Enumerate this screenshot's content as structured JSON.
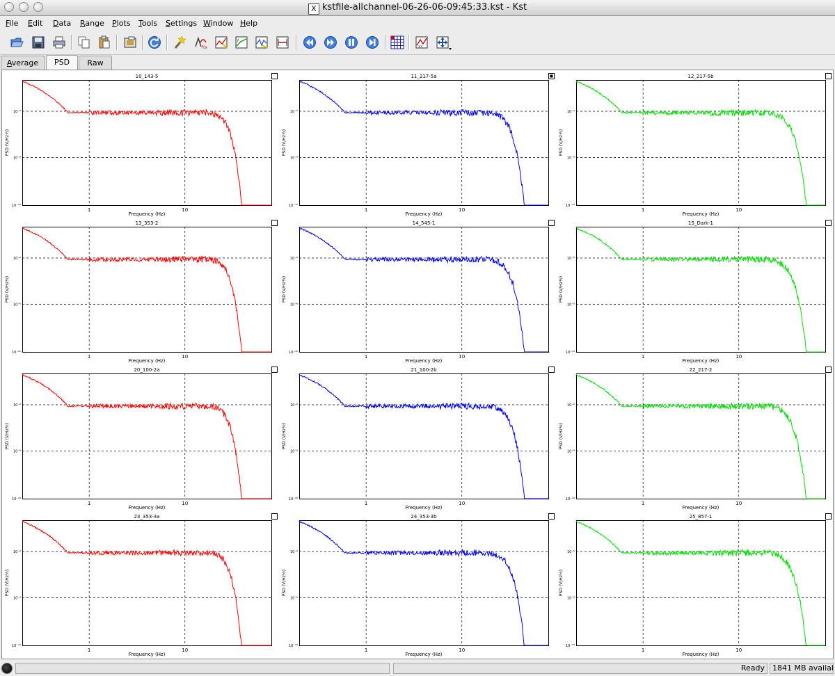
{
  "window": {
    "title": "kstfile-allchannel-06-26-06-09:45:33.kst - Kst",
    "x_logo": "X"
  },
  "menu": [
    {
      "underline": "F",
      "rest": "ile"
    },
    {
      "underline": "E",
      "rest": "dit"
    },
    {
      "underline": "D",
      "rest": "ata"
    },
    {
      "underline": "R",
      "rest": "ange"
    },
    {
      "underline": "P",
      "rest": "lots"
    },
    {
      "underline": "T",
      "rest": "ools"
    },
    {
      "underline": "S",
      "rest": "ettings"
    },
    {
      "underline": "W",
      "rest": "indow"
    },
    {
      "underline": "H",
      "rest": "elp"
    }
  ],
  "toolbar": [
    {
      "icon": "open-folder-icon"
    },
    {
      "icon": "save-icon"
    },
    {
      "icon": "print-icon"
    },
    {
      "icon": "copy-icon"
    },
    {
      "icon": "paste-icon"
    },
    {
      "icon": "export-image-icon"
    },
    {
      "icon": "reload-icon"
    },
    {
      "icon": "data-wizard-icon"
    },
    {
      "icon": "equation-icon"
    },
    {
      "icon": "new-plot-icon"
    },
    {
      "icon": "fit-icon"
    },
    {
      "icon": "filter-icon"
    },
    {
      "icon": "range-icon"
    },
    {
      "icon": "back-icon"
    },
    {
      "icon": "forward-icon"
    },
    {
      "icon": "pause-icon"
    },
    {
      "icon": "end-icon"
    },
    {
      "icon": "layout-grid-icon"
    },
    {
      "icon": "zoom-xy-icon"
    },
    {
      "icon": "zoom-dropdown-icon"
    }
  ],
  "tabs": [
    {
      "underline": "A",
      "rest": "verage",
      "active": false
    },
    {
      "underline": "",
      "rest": "PSD",
      "active": true
    },
    {
      "underline": "",
      "rest": "Raw",
      "active": false
    }
  ],
  "plots": [
    {
      "title": "10_143-5",
      "color": "#ff0000",
      "selected": false
    },
    {
      "title": "11_217-5a",
      "color": "#0000ee",
      "selected": true
    },
    {
      "title": "12_217-5b",
      "color": "#00e000",
      "selected": false
    },
    {
      "title": "13_353-2",
      "color": "#ff0000",
      "selected": false
    },
    {
      "title": "14_545-1",
      "color": "#0000ee",
      "selected": false
    },
    {
      "title": "15_Dark-1",
      "color": "#00e000",
      "selected": false
    },
    {
      "title": "20_100-2a",
      "color": "#ff0000",
      "selected": false
    },
    {
      "title": "21_100-2b",
      "color": "#0000ee",
      "selected": false
    },
    {
      "title": "22_217-2",
      "color": "#00e000",
      "selected": false
    },
    {
      "title": "23_353-3a",
      "color": "#ff0000",
      "selected": false
    },
    {
      "title": "24_353-3b",
      "color": "#0000ee",
      "selected": false
    },
    {
      "title": "25_857-1",
      "color": "#00e000",
      "selected": false
    }
  ],
  "axis": {
    "xlabel": "Frequency (Hz)",
    "ylabel": "PSD (V/Hz½)",
    "xticks": [
      "1",
      "10"
    ],
    "yticks": [
      "10⁻⁶",
      "10⁻⁸",
      "10⁻¹⁰"
    ]
  },
  "status": {
    "text": "Ready",
    "memory": "1841 MB availab"
  }
}
